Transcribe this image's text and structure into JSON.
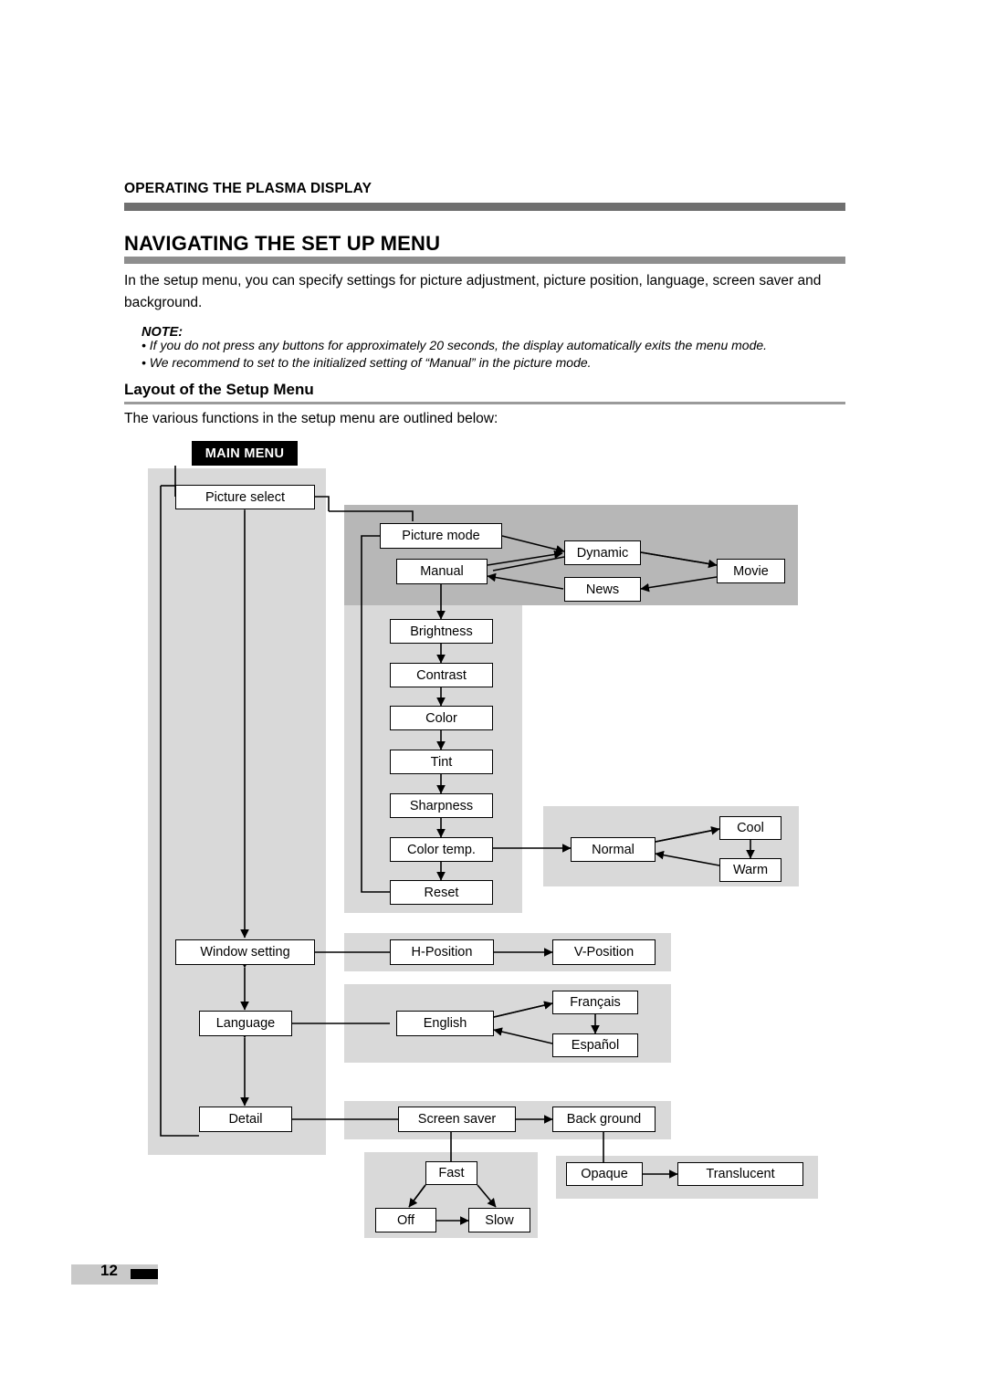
{
  "header": {
    "kicker": "OPERATING THE PLASMA DISPLAY",
    "title": "NAVIGATING THE SET UP MENU",
    "intro": "In the setup menu, you can specify settings for picture adjustment, picture position, language, screen saver and background.",
    "note_label": "NOTE:",
    "note_items": [
      "• If you do not press any buttons for approximately 20 seconds, the display automatically exits the menu mode.",
      "• We recommend to set to the initialized setting of “Manual” in the picture mode."
    ],
    "subtitle": "Layout of the Setup Menu",
    "outline_text": "The various functions in the setup menu are outlined below:"
  },
  "diagram": {
    "main_menu_label": "MAIN MENU",
    "nodes": {
      "picture_select": "Picture select",
      "picture_mode": "Picture mode",
      "manual": "Manual",
      "dynamic": "Dynamic",
      "news": "News",
      "movie": "Movie",
      "brightness": "Brightness",
      "contrast": "Contrast",
      "color": "Color",
      "tint": "Tint",
      "sharpness": "Sharpness",
      "color_temp": "Color temp.",
      "reset": "Reset",
      "normal": "Normal",
      "cool": "Cool",
      "warm": "Warm",
      "window_setting": "Window setting",
      "h_position": "H-Position",
      "v_position": "V-Position",
      "language": "Language",
      "english": "English",
      "francais": "Français",
      "espanol": "Español",
      "detail": "Detail",
      "screen_saver": "Screen saver",
      "back_ground": "Back ground",
      "fast": "Fast",
      "off": "Off",
      "slow": "Slow",
      "opaque": "Opaque",
      "translucent": "Translucent"
    }
  },
  "footer": {
    "page_number": "12"
  }
}
